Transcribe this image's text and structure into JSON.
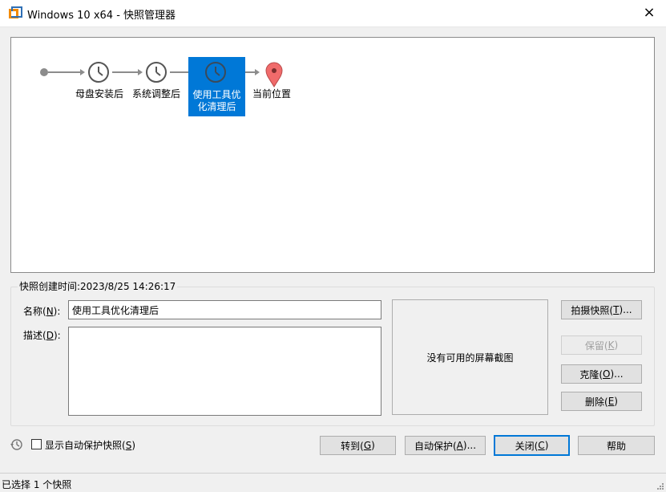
{
  "window": {
    "title": "Windows 10 x64 - 快照管理器",
    "close_glyph": "×",
    "app_icon": "vmware-icon"
  },
  "tree": {
    "nodes": [
      {
        "label": "母盘安装后",
        "icon": "clock-icon",
        "selected": false
      },
      {
        "label": "系统调整后",
        "icon": "clock-icon",
        "selected": false
      },
      {
        "label": "使用工具优化清理后",
        "icon": "clock-icon",
        "selected": true
      },
      {
        "label": "当前位置",
        "icon": "location-pin-icon",
        "selected": false
      }
    ],
    "colors": {
      "line": "#8c8c8c",
      "selected": "#0078d7",
      "pin": "#f06b6b",
      "icon": "#555555"
    }
  },
  "details": {
    "created_time": "快照创建时间:2023/8/25 14:26:17",
    "name_label_prefix": "名称(",
    "name_label_key": "N",
    "name_label_suffix": "):",
    "name_value": "使用工具优化清理后",
    "desc_label_prefix": "描述(",
    "desc_label_key": "D",
    "desc_label_suffix": "):",
    "desc_value": "",
    "no_screenshot": "没有可用的屏幕截图"
  },
  "side_buttons": {
    "take": {
      "text": "拍摄快照(",
      "key": "T",
      "tail": ")..."
    },
    "keep": {
      "text": "保留(",
      "key": "K",
      "tail": ")"
    },
    "clone": {
      "text": "克隆(",
      "key": "O",
      "tail": ")..."
    },
    "delete": {
      "text": "删除(",
      "key": "E",
      "tail": ")"
    }
  },
  "bottom": {
    "show_autoprotect": {
      "text": "显示自动保护快照(",
      "key": "S",
      "tail": ")",
      "checked": false
    },
    "goto": {
      "text": "转到(",
      "key": "G",
      "tail": ")"
    },
    "autoprotect": {
      "text": "自动保护(",
      "key": "A",
      "tail": ")..."
    },
    "close": {
      "text": "关闭(",
      "key": "C",
      "tail": ")"
    },
    "help": "帮助"
  },
  "status": {
    "text": "已选择 1 个快照"
  }
}
